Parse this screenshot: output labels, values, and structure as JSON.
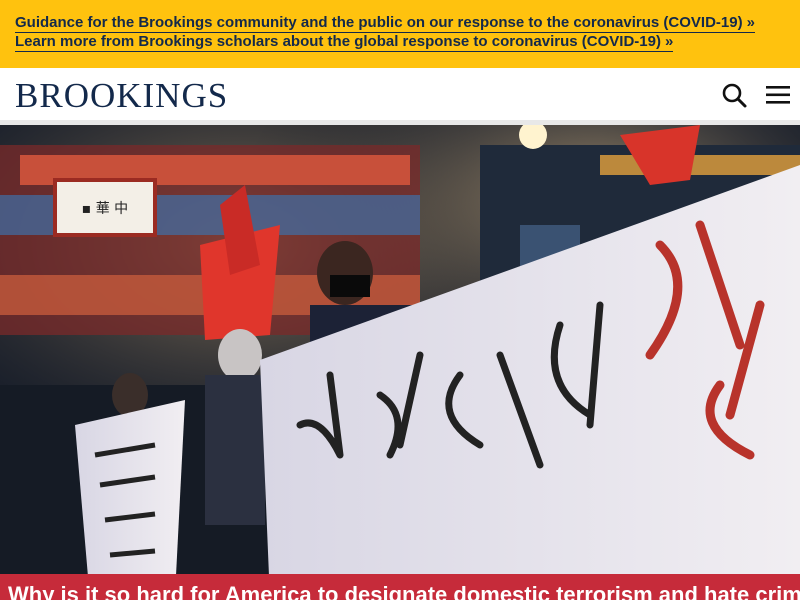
{
  "alerts": [
    {
      "text": "Guidance for the Brookings community and the public on our response to the coronavirus (COVID-19)",
      "arrow": "»"
    },
    {
      "text": "Learn more from Brookings scholars about the global response to coronavirus (COVID-19)",
      "arrow": "»"
    }
  ],
  "header": {
    "logo": "BROOKINGS",
    "search_icon": "search-icon",
    "menu_icon": "hamburger-menu-icon"
  },
  "hero": {
    "image": "protest-photo",
    "headline": "Why is it so hard for America to designate domestic terrorism and hate crimes?"
  },
  "colors": {
    "alert_bg": "#ffc20e",
    "brand_navy": "#13294b",
    "headline_bg": "#c62b3a"
  }
}
